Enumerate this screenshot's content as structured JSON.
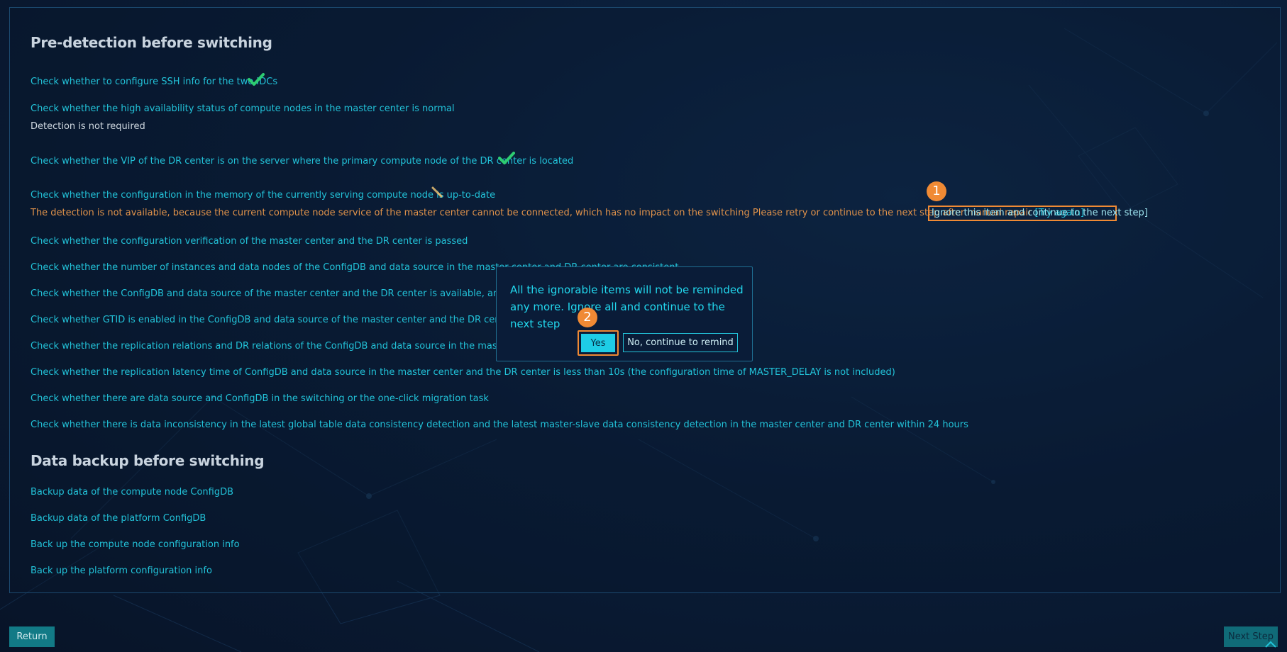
{
  "sections": {
    "pre_detection_title": "Pre-detection before switching",
    "backup_title": "Data backup before switching"
  },
  "checks": {
    "ssh": "Check whether to configure SSH info for the two IDCs",
    "ha": "Check whether the high availability status of compute nodes in the master center is normal",
    "ha_note": "Detection is not required",
    "vip": "Check whether the VIP of the DR center is on the server where the primary compute node of the DR center is located",
    "memory": "Check whether the configuration in the memory of the currently serving compute node is up-to-date",
    "memory_warning": "The detection is not available, because the current compute node service of the master center cannot be connected, which has no impact on the switching Please retry or continue to the next step after manual repair ",
    "try_again": "[Try again]",
    "ignore": "Ignore this item and continue to the next step]",
    "verify": "Check whether the configuration verification of the master center and the DR center is passed",
    "instances": "Check whether the number of instances and data nodes of the ConfigDB and data source in the master center and DR center are consistent",
    "available": "Check whether the ConfigDB and data source of the master center and the DR center is available, and whether the My",
    "gtid": "Check whether GTID is enabled in the ConfigDB and data source of the master center and the DR center",
    "replication": "Check whether the replication relations and DR relations of the ConfigDB and data source in the master center and th",
    "latency": "Check whether the replication latency time of ConfigDB and data source in the master center and the DR center is less than 10s (the configuration time of MASTER_DELAY is not included)",
    "migration": "Check whether there are data source and ConfigDB in the switching or the one-click migration task",
    "inconsistency": "Check whether there is data inconsistency in the latest global table data consistency detection and the latest master-slave data consistency detection in the master center and DR center within 24 hours"
  },
  "backup": {
    "node_configdb": "Backup data of the compute node ConfigDB",
    "platform_configdb": "Backup data of the platform ConfigDB",
    "node_config": "Back up the compute node configuration info",
    "platform_config": "Back up the platform configuration info"
  },
  "popup": {
    "message": "All the ignorable items will not be reminded any more. Ignore all and continue to the next step",
    "yes": "Yes",
    "no": "No, continue to remind"
  },
  "badges": {
    "one": "1",
    "two": "2"
  },
  "footer": {
    "return": "Return",
    "next": "Next Step"
  },
  "icons": {
    "ok": "check-icon",
    "pending": "broom-icon"
  },
  "colors": {
    "accent": "#22c2d8",
    "warning": "#e0924a",
    "success": "#2ecc71",
    "highlight": "#f08a34"
  }
}
